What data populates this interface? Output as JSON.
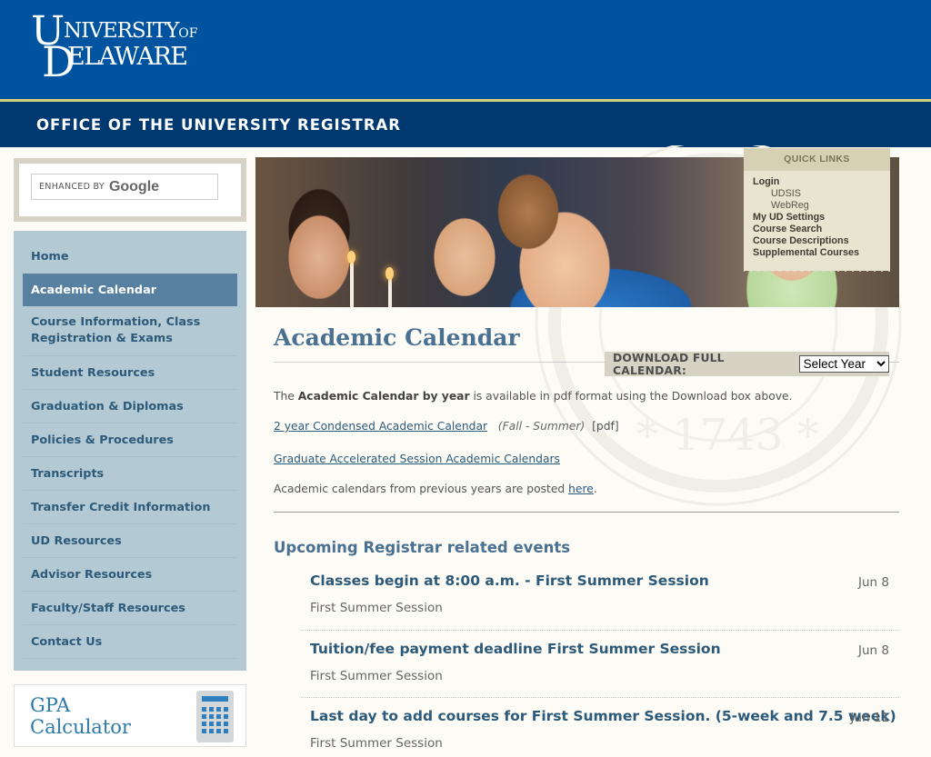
{
  "header": {
    "logo": {
      "u": "U",
      "d": "D",
      "line1": "NIVERSITY",
      "of": "OF",
      "line2": "ELAWARE",
      "alt": "University of Delaware"
    },
    "office_title": "OFFICE OF THE UNIVERSITY REGISTRAR"
  },
  "search": {
    "enhanced_by": "ENHANCED BY",
    "provider": "Google"
  },
  "sidebar": {
    "items": [
      {
        "label": "Home",
        "active": false
      },
      {
        "label": "Academic Calendar",
        "active": true
      },
      {
        "label": "Course Information, Class Registration & Exams",
        "active": false
      },
      {
        "label": "Student Resources",
        "active": false
      },
      {
        "label": "Graduation & Diplomas",
        "active": false
      },
      {
        "label": "Policies & Procedures",
        "active": false
      },
      {
        "label": "Transcripts",
        "active": false
      },
      {
        "label": "Transfer Credit Information",
        "active": false
      },
      {
        "label": "UD Resources",
        "active": false
      },
      {
        "label": "Advisor Resources",
        "active": false
      },
      {
        "label": "Faculty/Staff Resources",
        "active": false
      },
      {
        "label": "Contact Us",
        "active": false
      }
    ],
    "gpa": {
      "line1": "GPA",
      "line2": "Calculator",
      "icon": "calculator-icon"
    }
  },
  "quick_links": {
    "heading": "QUICK LINKS",
    "items": [
      {
        "label": "Login",
        "level": "main"
      },
      {
        "label": "UDSIS",
        "level": "sub"
      },
      {
        "label": "WebReg",
        "level": "sub"
      },
      {
        "label": "My UD Settings",
        "level": "main"
      },
      {
        "label": "Course Search",
        "level": "main"
      },
      {
        "label": "Course Descriptions",
        "level": "main"
      },
      {
        "label": "Supplemental Courses",
        "level": "main"
      }
    ]
  },
  "main": {
    "title": "Academic Calendar",
    "download": {
      "label": "DOWNLOAD FULL CALENDAR:",
      "selected": "Select Year"
    },
    "intro": {
      "pre": "The ",
      "bold": "Academic Calendar by year",
      "post": " is available in pdf format using the Download box above."
    },
    "condensed": {
      "link": "2 year Condensed Academic Calendar",
      "note": "(Fall - Summer)",
      "format": "[pdf]"
    },
    "graduate_link": "Graduate Accelerated Session Academic Calendars",
    "previous": {
      "pre": "Academic calendars from previous years are posted ",
      "link": "here",
      "post": "."
    },
    "events_heading": "Upcoming Registrar related events",
    "events": [
      {
        "title": "Classes begin at 8:00 a.m. - First Summer Session",
        "session": "First Summer Session",
        "date": "Jun 8"
      },
      {
        "title": "Tuition/fee payment deadline First Summer Session",
        "session": "First Summer Session",
        "date": "Jun 8"
      },
      {
        "title": "Last day to add courses for First Summer Session. (5-week and 7.5 week)",
        "session": "First Summer Session",
        "date": "Jun 11"
      }
    ]
  },
  "colors": {
    "brand_blue": "#00539f",
    "dark_blue": "#003870",
    "gold": "#d4cf7a",
    "nav_bg": "#b3c9d3",
    "nav_active": "#5880a0",
    "link": "#2e5a79"
  }
}
